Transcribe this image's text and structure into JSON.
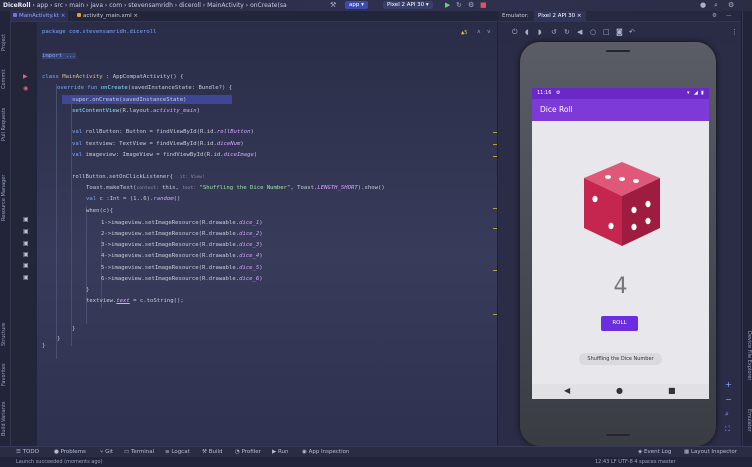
{
  "titlebar": {
    "project": "DiceRoll",
    "crumbs": "› app › src › main › java › com › stevensamridh › diceroll › MainActivity › onCreate(sa",
    "config": "app ▾",
    "device": "Pixel 2 API 30 ▾"
  },
  "tabs": [
    {
      "label": "MainActivity.kt ×",
      "active": true
    },
    {
      "label": "activity_main.xml ×",
      "active": false
    }
  ],
  "left_panels": [
    "Project",
    "Commit",
    "Pull Requests",
    "Resource Manager",
    "Structure",
    "Favorites",
    "Build Variants"
  ],
  "right_panels": [
    "Device File Explorer",
    "Emulator"
  ],
  "editor": {
    "warning_count": "▲5",
    "lines": {
      "pkg": "package com.stevensamridh.diceroll",
      "imp": "import ...",
      "cls_kw": "class",
      "cls_name": "MainActivity",
      "cls_rest": " : AppCompatActivity() {",
      "ov_kw": "override fun",
      "ov_fn": "onCreate",
      "ov_rest": "(savedInstanceState: Bundle?) {",
      "sup": "super.onCreate(savedInstanceState)",
      "scv_fn": "setContentView",
      "scv_rest": "(R.layout.",
      "scv_it": "activity_main",
      "scv_end": ")",
      "v1_kw": "val",
      "v1": " rollButton: Button = findViewById(R.id.",
      "v1_it": "rollButton",
      "v2_kw": "val",
      "v2": " textview: TextView = findViewById(R.id.",
      "v2_it": "diceNum",
      "v3_kw": "val",
      "v3": " imageview: ImageView = findViewById(R.id.",
      "v3_it": "diceImage",
      "listener": "rollButton.setOnClickListener{",
      "listener_hint": "it: View!",
      "toast_a": "Toast.makeText(",
      "toast_hint1": "context:",
      "toast_b": " this, ",
      "toast_hint2": "text:",
      "toast_str": " \"Shuffling the Dice Number\"",
      "toast_c": ", Toast.",
      "toast_it": "LENGTH_SHORT",
      "toast_d": ").show()",
      "valc_kw": "val",
      "valc": " c :Int = (1..6).",
      "valc_fn": "random",
      "valc_end": "()",
      "when": "when(c){",
      "c1": "1->imageview.setImageResource(R.drawable.",
      "c1_it": "dice_1",
      "c2": "2->imageview.setImageResource(R.drawable.",
      "c2_it": "dice_2",
      "c3": "3->imageview.setImageResource(R.drawable.",
      "c3_it": "dice_3",
      "c4": "4->imageview.setImageResource(R.drawable.",
      "c4_it": "dice_4",
      "c5": "5->imageview.setImageResource(R.drawable.",
      "c5_it": "dice_5",
      "c6": "6->imageview.setImageResource(R.drawable.",
      "c6_it": "dice_6",
      "close_paren": ")",
      "brace": "}",
      "tv_a": "textview.",
      "tv_it": "text",
      "tv_b": " = c.toString();"
    }
  },
  "emulator": {
    "header_label": "Emulator:",
    "device_tab": "Pixel 2 API 30 ×",
    "status_time": "11:16",
    "app_title": "Dice Roll",
    "dice_number": "4",
    "roll_label": "ROLL",
    "toast": "Shuffling the Dice Number"
  },
  "bottombar": [
    "TODO",
    "Problems",
    "Git",
    "Terminal",
    "Logcat",
    "Build",
    "Profiler",
    "Run",
    "App Inspection",
    "Event Log",
    "Layout Inspector"
  ],
  "statusline": {
    "message": "Launch succeeded (moments ago)",
    "position": "12:43  LF  UTF-8  4 spaces  master"
  },
  "colors": {
    "accent": "#3b4bb0",
    "app_purple": "#7e3ad7",
    "dice_red": "#c4264f",
    "button_purple": "#6a2ee0"
  }
}
